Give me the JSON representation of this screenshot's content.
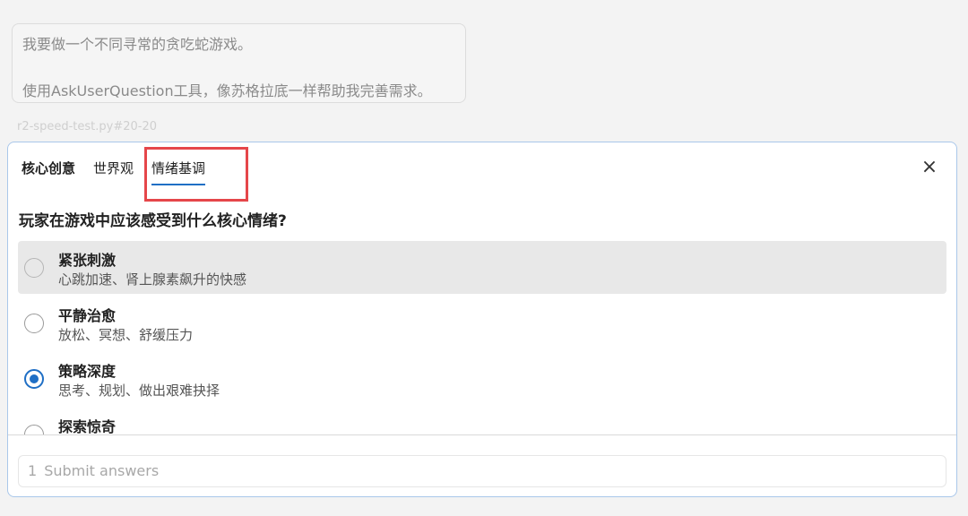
{
  "prompt": {
    "line1": "我要做一个不同寻常的贪吃蛇游戏。",
    "line2": "使用AskUserQuestion工具，像苏格拉底一样帮助我完善需求。"
  },
  "file_ref": "r2-speed-test.py#20-20",
  "tabs": [
    {
      "label": "核心创意"
    },
    {
      "label": "世界观"
    },
    {
      "label": "情绪基调"
    }
  ],
  "close_icon": "×",
  "question": "玩家在游戏中应该感受到什么核心情绪?",
  "options": [
    {
      "title": "紧张刺激",
      "desc": "心跳加速、肾上腺素飙升的快感"
    },
    {
      "title": "平静治愈",
      "desc": "放松、冥想、舒缓压力"
    },
    {
      "title": "策略深度",
      "desc": "思考、规划、做出艰难抉择"
    },
    {
      "title": "探索惊奇",
      "desc": ""
    }
  ],
  "submit": {
    "count": "1",
    "label": "Submit answers"
  },
  "colors": {
    "accent": "#1f6fc5",
    "highlight": "#e5464a",
    "panel_border": "#a9c7ea"
  }
}
